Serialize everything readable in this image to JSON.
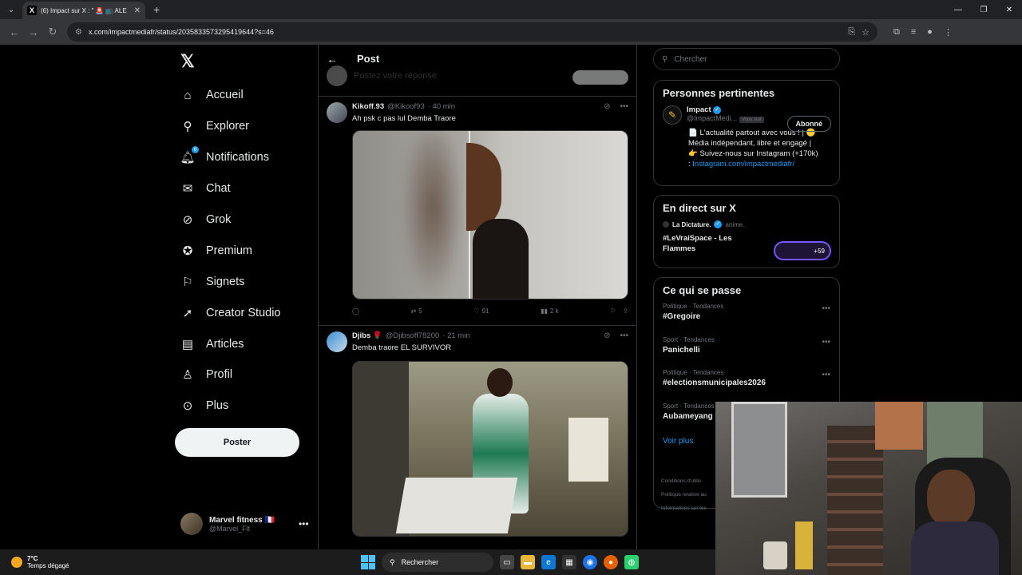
{
  "browser": {
    "tab_title": "(6) Impact sur X : \" 🚨 ​📺 ALE",
    "tab_favicon": "X",
    "url": "x.com/impactmediafr/status/2035833573295419644?s=46"
  },
  "sidebar": {
    "logo": "𝕏",
    "items": [
      {
        "label": "Accueil",
        "icon": "home-icon"
      },
      {
        "label": "Explorer",
        "icon": "search-icon"
      },
      {
        "label": "Notifications",
        "icon": "bell-icon",
        "badge": "6"
      },
      {
        "label": "Chat",
        "icon": "mail-icon"
      },
      {
        "label": "Grok",
        "icon": "grok-icon"
      },
      {
        "label": "Premium",
        "icon": "premium-icon"
      },
      {
        "label": "Signets",
        "icon": "bookmark-icon"
      },
      {
        "label": "Creator Studio",
        "icon": "rocket-icon"
      },
      {
        "label": "Articles",
        "icon": "article-icon"
      },
      {
        "label": "Profil",
        "icon": "person-icon"
      },
      {
        "label": "Plus",
        "icon": "more-circle-icon"
      }
    ],
    "post_button": "Poster",
    "account": {
      "name": "Marvel fitness 🇫🇷",
      "handle": "@Marvel_Flt"
    }
  },
  "feed": {
    "title": "Post",
    "reply_placeholder": "Postez votre réponse",
    "tweets": [
      {
        "name": "Kikoff.93",
        "handle": "@Kikoof93",
        "time": "· 40 min",
        "text": "Ah psk c pas lul Demba Traore",
        "replies": "",
        "reposts": "5",
        "likes": "91",
        "views": "2 k"
      },
      {
        "name": "Djibs 🌹",
        "handle": "@Djibsoff78200",
        "time": "· 21 min",
        "text": "Demba traore EL SURVIVOR"
      }
    ]
  },
  "right": {
    "search_placeholder": "Chercher",
    "people": {
      "title": "Personnes pertinentes",
      "name": "Impact",
      "handle": "@ImpactMedi...",
      "follows_you": "Vous suit",
      "follow_button": "Abonné",
      "bio_lines": [
        "📄 L'actualité partout avec vous ! | 🟡",
        "Média indépendant, libre et engagé |",
        "👉 Suivez-nous sur Instagram (+170k)"
      ],
      "bio_prefix": ": ",
      "bio_link": "Instagram.com/impactmediafr/"
    },
    "live": {
      "title": "En direct sur X",
      "host": "La Dictature.",
      "host_action": "anime.",
      "space_title": "#LeVraiSpace - Les Flammes",
      "listeners": "+59"
    },
    "trends": {
      "title": "Ce qui se passe",
      "items": [
        {
          "category": "Politique · Tendances",
          "name": "#Gregoire"
        },
        {
          "category": "Sport · Tendances",
          "name": "Panichelli"
        },
        {
          "category": "Politique · Tendances",
          "name": "#electionsmunicipales2026"
        },
        {
          "category": "Sport · Tendances",
          "name": "Aubameyang"
        }
      ],
      "see_more": "Voir plus"
    },
    "footer": [
      "Conditions d'utilis",
      "Politique relative au",
      "Informations sur les"
    ]
  },
  "taskbar": {
    "temp": "7°C",
    "weather": "Temps dégagé",
    "search": "Rechercher"
  },
  "colors": {
    "accent": "#1d9bf0",
    "bg": "#000000",
    "border": "#2f3336"
  }
}
